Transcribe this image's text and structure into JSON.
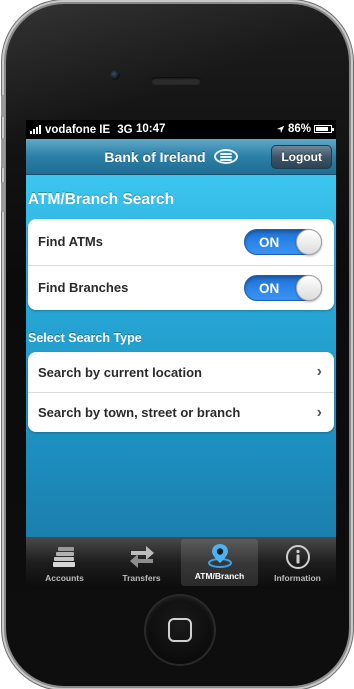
{
  "status_bar": {
    "carrier": "vodafone IE",
    "network": "3G",
    "time": "10:47",
    "battery": "86%"
  },
  "nav": {
    "title": "Bank of Ireland",
    "logout_label": "Logout"
  },
  "atm_branch_search": {
    "title": "ATM/Branch Search",
    "toggles": [
      {
        "label": "Find ATMs",
        "state": "ON"
      },
      {
        "label": "Find Branches",
        "state": "ON"
      }
    ]
  },
  "search_type": {
    "title": "Select Search Type",
    "options": [
      {
        "label": "Search by current location"
      },
      {
        "label": "Search by town, street or branch"
      }
    ]
  },
  "tab_bar": {
    "tabs": [
      {
        "label": "Accounts",
        "icon": "accounts-icon"
      },
      {
        "label": "Transfers",
        "icon": "transfers-icon"
      },
      {
        "label": "ATM/Branch",
        "icon": "location-pin-icon",
        "active": true
      },
      {
        "label": "Information",
        "icon": "info-icon"
      }
    ]
  },
  "colors": {
    "content_bg": "#27a7d6",
    "toggle_on": "#2c86ec",
    "nav_bar": "#2c7fa6",
    "tab_bar": "#1d1d1d"
  }
}
